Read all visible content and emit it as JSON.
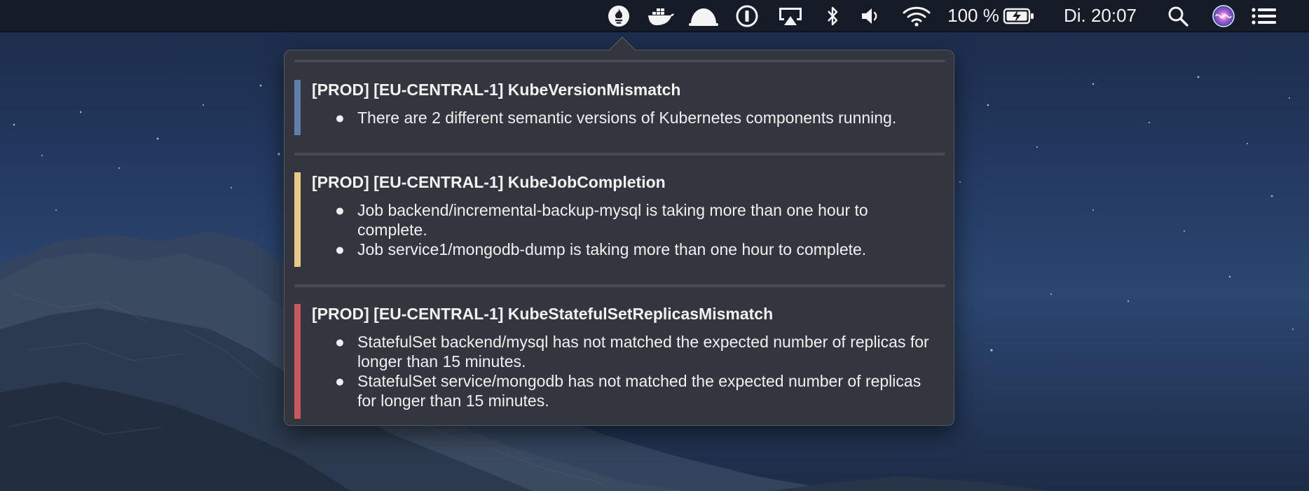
{
  "menubar": {
    "battery_percent": "100 %",
    "clock": "Di. 20:07",
    "icons": [
      "prometheus-icon",
      "docker-icon",
      "cloud-icon",
      "one-password-icon",
      "airplay-icon",
      "bluetooth-icon",
      "volume-icon",
      "wifi-icon",
      "battery-charging-icon",
      "spotlight-search-icon",
      "siri-icon",
      "notification-center-icon"
    ]
  },
  "alerts": [
    {
      "title": "[PROD] [EU-CENTRAL-1] KubeVersionMismatch",
      "color": "#5f7fa8",
      "messages": [
        "There are 2 different semantic versions of Kubernetes components running."
      ]
    },
    {
      "title": "[PROD] [EU-CENTRAL-1] KubeJobCompletion",
      "color": "#e8c887",
      "messages": [
        "Job backend/incremental-backup-mysql is taking more than one hour to complete.",
        "Job service1/mongodb-dump is taking more than one hour to complete."
      ]
    },
    {
      "title": "[PROD] [EU-CENTRAL-1] KubeStatefulSetReplicasMismatch",
      "color": "#c7585e",
      "messages": [
        "StatefulSet backend/mysql has not matched the expected number of replicas for longer than 15 minutes.",
        "StatefulSet service/mongodb has not matched the expected number of replicas for longer than 15 minutes."
      ]
    }
  ],
  "bullet": "●"
}
